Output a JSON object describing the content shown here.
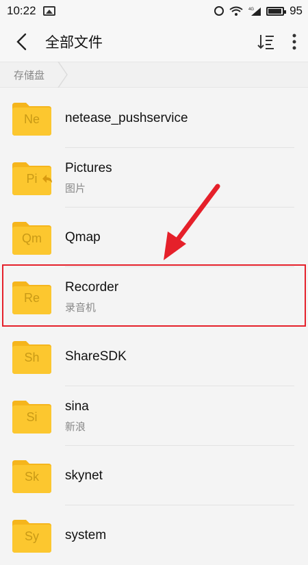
{
  "status_bar": {
    "time": "10:22",
    "battery": "95",
    "battery_level": 0.95,
    "icons": [
      "gallery-icon",
      "alarm-icon",
      "wifi-icon",
      "signal-4g-icon",
      "battery-icon"
    ]
  },
  "header": {
    "title": "全部文件",
    "back_icon": "chevron-left-icon",
    "sort_icon": "sort-icon",
    "more_icon": "more-vertical-icon"
  },
  "breadcrumb": {
    "items": [
      "存储盘"
    ]
  },
  "files": [
    {
      "name": "netease_pushservice",
      "abbr": "Ne",
      "subtitle": ""
    },
    {
      "name": "Pictures",
      "abbr": "Pi",
      "subtitle": "图片",
      "shortcut": true
    },
    {
      "name": "Qmap",
      "abbr": "Qm",
      "subtitle": ""
    },
    {
      "name": "Recorder",
      "abbr": "Re",
      "subtitle": "录音机",
      "highlighted": true
    },
    {
      "name": "ShareSDK",
      "abbr": "Sh",
      "subtitle": ""
    },
    {
      "name": "sina",
      "abbr": "Si",
      "subtitle": "新浪"
    },
    {
      "name": "skynet",
      "abbr": "Sk",
      "subtitle": ""
    },
    {
      "name": "system",
      "abbr": "Sy",
      "subtitle": ""
    }
  ],
  "colors": {
    "folder": "#fcc72f",
    "folder_tab": "#f5b51c",
    "annotation": "#e5202a"
  }
}
